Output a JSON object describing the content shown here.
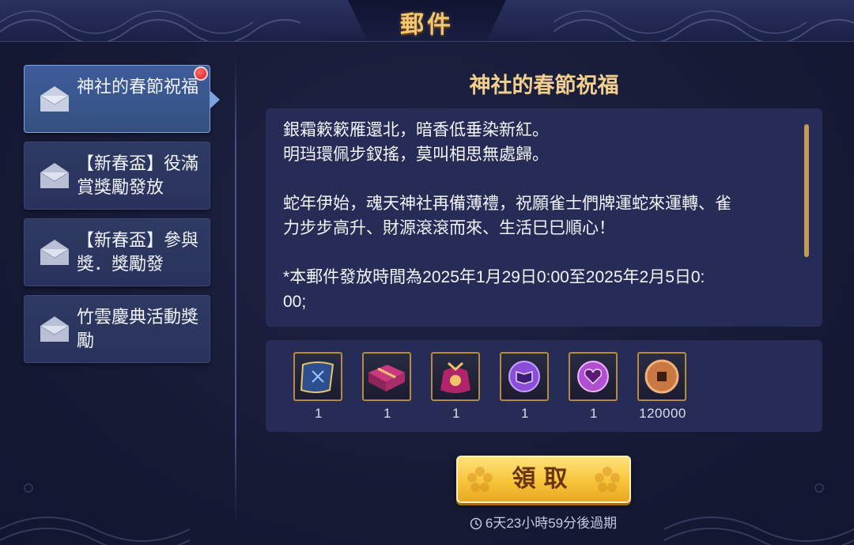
{
  "header": {
    "title": "郵件"
  },
  "mail_list": {
    "items": [
      {
        "label": "神社的春節祝福",
        "selected": true,
        "unread": true,
        "icon": "envelope-icon"
      },
      {
        "label": "【新春盃】役滿賞獎勵發放",
        "selected": false,
        "unread": false,
        "icon": "envelope-icon"
      },
      {
        "label": "【新春盃】參與獎．獎勵發",
        "selected": false,
        "unread": false,
        "icon": "envelope-icon"
      },
      {
        "label": "竹雲慶典活動獎勵",
        "selected": false,
        "unread": false,
        "icon": "envelope-icon"
      }
    ]
  },
  "mail": {
    "title": "神社的春節祝福",
    "body": {
      "line1": "銀霜簌簌雁還北，暗香低垂染新紅。",
      "line2": "明珰環佩步釵搖，莫叫相思無處歸。",
      "line3": "蛇年伊始，魂天神社再備薄禮，祝願雀士們牌運蛇來運轉、雀",
      "line4": "力步步高升、財源滾滾而來、生活巳巳順心！",
      "line5": "*本郵件發放時間為2025年1月29日0:00至2025年2月5日0:",
      "line6": "00;"
    },
    "rewards": [
      {
        "icon": "scroll-ticket-icon",
        "count": "1"
      },
      {
        "icon": "gift-box-icon",
        "count": "1"
      },
      {
        "icon": "lucky-bag-icon",
        "count": "1"
      },
      {
        "icon": "purple-book-token-icon",
        "count": "1"
      },
      {
        "icon": "purple-heart-token-icon",
        "count": "1"
      },
      {
        "icon": "copper-coin-icon",
        "count": "120000"
      }
    ],
    "claim_label": "領取",
    "expire_text": "6天23小時59分後過期"
  },
  "colors": {
    "accent_gold": "#f3cf8e",
    "button_gold": "#f7c43a",
    "selected_item": "#3f5c9c",
    "panel": "#262c55"
  }
}
